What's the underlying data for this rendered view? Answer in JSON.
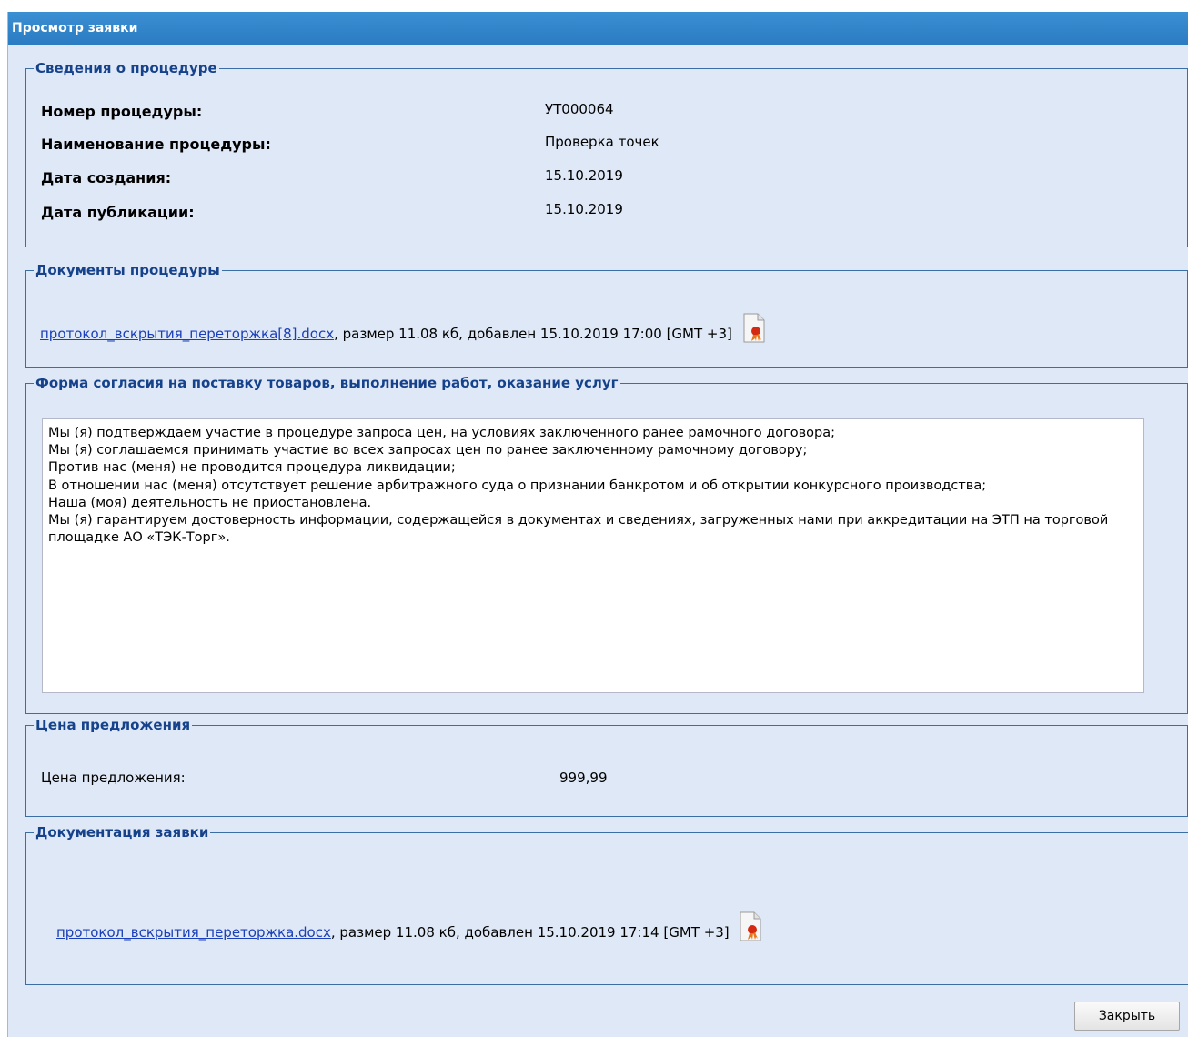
{
  "window": {
    "title": "Просмотр заявки"
  },
  "procedure_info": {
    "legend": "Сведения о процедуре",
    "fields": [
      {
        "label": "Номер процедуры:",
        "value": "УТ000064"
      },
      {
        "label": "Наименование процедуры:",
        "value": "Проверка точек"
      },
      {
        "label": "Дата создания:",
        "value": "15.10.2019"
      },
      {
        "label": "Дата публикации:",
        "value": "15.10.2019"
      }
    ]
  },
  "procedure_docs": {
    "legend": "Документы процедуры",
    "file": {
      "name": "протокол_вскрытия_переторжка[8].docx",
      "details": ", размер 11.08 кб, добавлен 15.10.2019 17:00 [GMT +3]",
      "icon": "signed-document-icon"
    }
  },
  "consent_form": {
    "legend": "Форма согласия на поставку товаров, выполнение работ, оказание услуг",
    "text": "Мы (я) подтверждаем участие в процедуре запроса цен, на условиях заключенного ранее рамочного договора;\nМы (я) соглашаемся принимать участие во всех запросах цен по ранее заключенному рамочному договору;\nПротив нас (меня) не проводится процедура ликвидации;\nВ отношении нас (меня) отсутствует решение арбитражного суда о признании банкротом и об открытии конкурсного производства;\nНаша (моя) деятельность не приостановлена.\nМы (я) гарантируем достоверность информации, содержащейся в документах и сведениях, загруженных нами при аккредитации на ЭТП на торговой площадке АО «ТЭК-Торг»."
  },
  "offer_price": {
    "legend": "Цена предложения",
    "label": "Цена предложения:",
    "value": "999,99"
  },
  "application_docs": {
    "legend": "Документация заявки",
    "file": {
      "name": "протокол_вскрытия_переторжка.docx",
      "details": ", размер 11.08 кб, добавлен 15.10.2019 17:14 [GMT +3]",
      "icon": "signed-document-icon"
    }
  },
  "buttons": {
    "close": "Закрыть"
  },
  "colors": {
    "titlebar": "#2b7bc2",
    "panel_background": "#dfe8f6",
    "legend_text": "#15428b",
    "link": "#1a3fb8",
    "border": "#3a6ea5"
  }
}
